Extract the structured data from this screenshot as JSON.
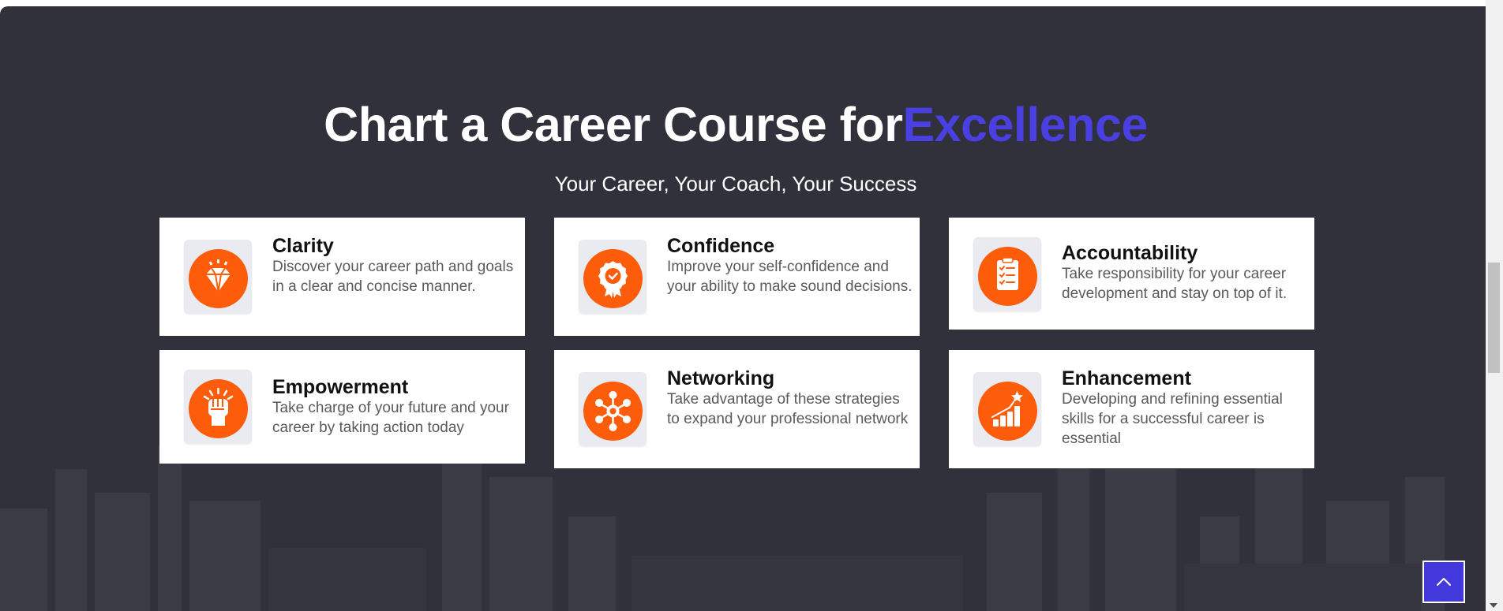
{
  "section": {
    "heading_main": "Chart a Career Course for",
    "heading_accent": "Excellence",
    "subheading": "Your Career, Your Coach, Your Success"
  },
  "cards": [
    {
      "title": "Clarity",
      "description": "Discover your career path and goals in a clear and concise manner.",
      "icon": "diamond-icon"
    },
    {
      "title": "Confidence",
      "description": "Improve your self-confidence and your ability to make sound decisions.",
      "icon": "badge-check-icon"
    },
    {
      "title": "Accountability",
      "description": "Take responsibility for your career development and stay on top of it.",
      "icon": "clipboard-checklist-icon"
    },
    {
      "title": "Empowerment",
      "description": "Take charge of your future and your career by taking action today",
      "icon": "raised-fist-icon"
    },
    {
      "title": "Networking",
      "description": "Take advantage of these strategies to expand your professional network",
      "icon": "network-icon"
    },
    {
      "title": "Enhancement",
      "description": "Developing and refining essential skills for a successful career is essential",
      "icon": "growth-chart-star-icon"
    }
  ],
  "colors": {
    "background": "#30313a",
    "accent": "#4a3fe0",
    "icon_orange": "#fd5c0a",
    "back_to_top": "#4338dc"
  },
  "controls": {
    "back_to_top_icon": "chevron-up-icon"
  }
}
